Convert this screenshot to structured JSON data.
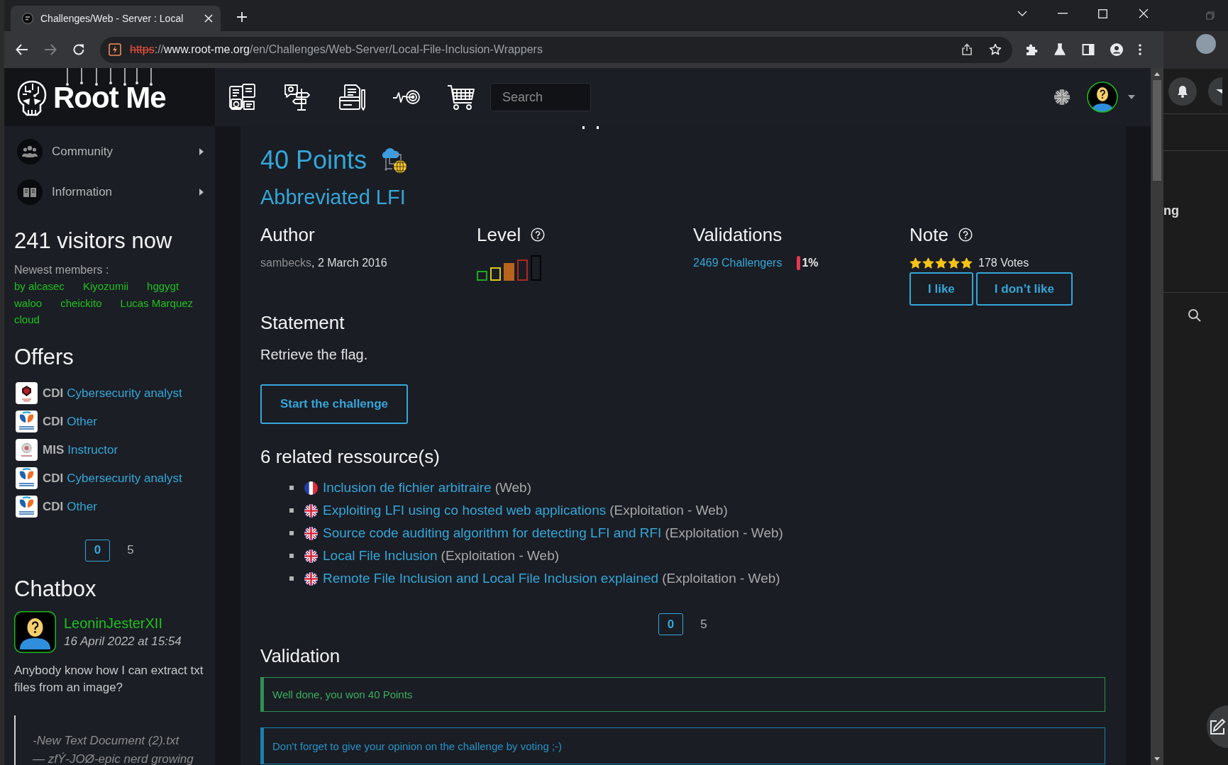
{
  "browser": {
    "tab": {
      "title": "Challenges/Web - Server : Local"
    },
    "forward": {
      "disabled": true
    },
    "address": {
      "scheme": "https",
      "separator": "://",
      "host": "www.root-me.org",
      "path": "/en/Challenges/Web-Server/Local-File-Inclusion-Wrappers"
    }
  },
  "header": {
    "logo": "Root Me",
    "search": {
      "placeholder": "Search"
    }
  },
  "sidebar": {
    "menu": [
      {
        "kind": "people",
        "label": "Community"
      },
      {
        "kind": "book",
        "label": "Information"
      }
    ],
    "visitors": {
      "title": "241 visitors now",
      "subtitle": "Newest members :",
      "members": [
        "by alcasec",
        "Kiyozumii",
        "hggygt",
        "waloo",
        "cheickito",
        "Lucas Marquez",
        "cloud"
      ]
    },
    "offers": {
      "title": "Offers",
      "items": [
        {
          "kind": "shield",
          "contract": "CDI",
          "job": "Cybersecurity analyst"
        },
        {
          "kind": "swirl",
          "contract": "CDI",
          "job": "Other"
        },
        {
          "kind": "seal",
          "contract": "MIS",
          "job": "Instructor"
        },
        {
          "kind": "swirl",
          "contract": "CDI",
          "job": "Cybersecurity analyst"
        },
        {
          "kind": "swirl",
          "contract": "CDI",
          "job": "Other"
        }
      ],
      "pages": [
        {
          "label": "0",
          "selected": true
        },
        {
          "label": "5",
          "selected": false
        }
      ]
    },
    "chatbox": {
      "title": "Chatbox",
      "messages": [
        {
          "author": "LeoninJesterXII",
          "date": "16 April 2022 at 15:54",
          "text": "Anybody know how I can extract txt files from an image?",
          "quote": [
            "-New Text Document (2).txt",
            "— zfÝ-JOØ-epic nerd growing"
          ]
        }
      ]
    }
  },
  "challenge": {
    "points": "40 Points",
    "title": "Abbreviated LFI",
    "author": {
      "heading": "Author",
      "name": "sambecks",
      "date": ", 2 March 2016"
    },
    "difficulty": {
      "heading": "Level",
      "bars": [
        {
          "color": "#1fa81f",
          "selected": false
        },
        {
          "color": "#d9c91a",
          "selected": false
        },
        {
          "color": "#b8641c",
          "selected": true
        },
        {
          "color": "#b0281a",
          "selected": false
        },
        {
          "color": "#050505",
          "selected": false
        }
      ]
    },
    "validations": {
      "heading": "Validations",
      "count": "2469 Challengers",
      "percent": "1%"
    },
    "note": {
      "heading": "Note",
      "stars": 5,
      "votes": "178 Votes",
      "buttons": [
        "I like",
        "I don’t like"
      ]
    },
    "statement": {
      "heading": "Statement",
      "text": "Retrieve the flag.",
      "button": "Start the challenge"
    },
    "resources": {
      "heading": "6 related ressource(s)",
      "items": [
        {
          "kind": "french",
          "title": "Inclusion de fichier arbitraire",
          "category": "(Web)"
        },
        {
          "kind": "british",
          "title": "Exploiting LFI using co hosted web applications",
          "category": "(Exploitation - Web)"
        },
        {
          "kind": "british",
          "title": "Source code auditing algorithm for detecting LFI and RFI",
          "category": "(Exploitation - Web)"
        },
        {
          "kind": "british",
          "title": "Local File Inclusion",
          "category": "(Exploitation - Web)"
        },
        {
          "kind": "british",
          "title": "Remote File Inclusion and Local File Inclusion explained",
          "category": "(Exploitation - Web)"
        }
      ],
      "pages": [
        {
          "label": "0",
          "selected": true
        },
        {
          "label": "5",
          "selected": false
        }
      ]
    },
    "validation": {
      "heading": "Validation",
      "alerts": [
        {
          "kind": "success",
          "text": "Well done, you won 40 Points"
        },
        {
          "kind": "info",
          "text": "Don't forget to give your opinion on the challenge by voting ;-)"
        }
      ]
    }
  },
  "background_window": {
    "label": "ng"
  }
}
